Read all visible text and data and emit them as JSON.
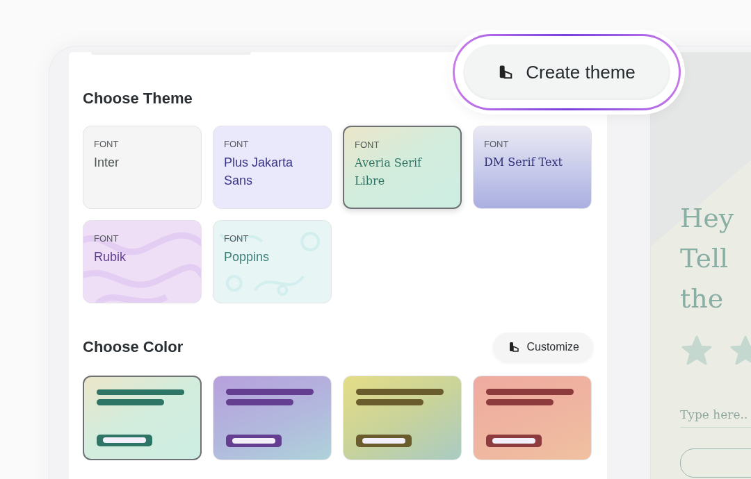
{
  "create_button": {
    "label": "Create theme"
  },
  "theme_section": {
    "title": "Choose Theme",
    "themes": [
      {
        "caption": "FONT",
        "name": "Inter",
        "kind": "plain",
        "serif": false,
        "color": "#4d5452",
        "selected": false
      },
      {
        "caption": "FONT",
        "name": "Plus Jakarta Sans",
        "kind": "lavender",
        "serif": false,
        "color": "#3b3587",
        "selected": false
      },
      {
        "caption": "FONT",
        "name": "Averia Serif Libre",
        "kind": "mint",
        "serif": true,
        "color": "#2f7565",
        "selected": true
      },
      {
        "caption": "FONT",
        "name": "DM Serif Text",
        "kind": "indigo",
        "serif": true,
        "color": "#2f2f7a",
        "selected": false
      },
      {
        "caption": "FONT",
        "name": "Rubik",
        "kind": "swirl",
        "serif": false,
        "color": "#633f93",
        "selected": false
      },
      {
        "caption": "FONT",
        "name": "Poppins",
        "kind": "doodle",
        "serif": false,
        "color": "#3d7f78",
        "selected": false
      }
    ]
  },
  "color_section": {
    "title": "Choose Color",
    "customize_button": "Customize",
    "palettes": [
      {
        "kind": "mint",
        "color": "#2f7565",
        "selected": true
      },
      {
        "kind": "violet",
        "color": "#643e91",
        "selected": false
      },
      {
        "kind": "olive",
        "color": "#6b5c2e",
        "selected": false
      },
      {
        "kind": "coral",
        "color": "#8e3b3d",
        "selected": false
      }
    ]
  },
  "preview": {
    "heading_lines": [
      "Hey",
      "Tell",
      "the"
    ],
    "input_placeholder": "Type here.."
  }
}
